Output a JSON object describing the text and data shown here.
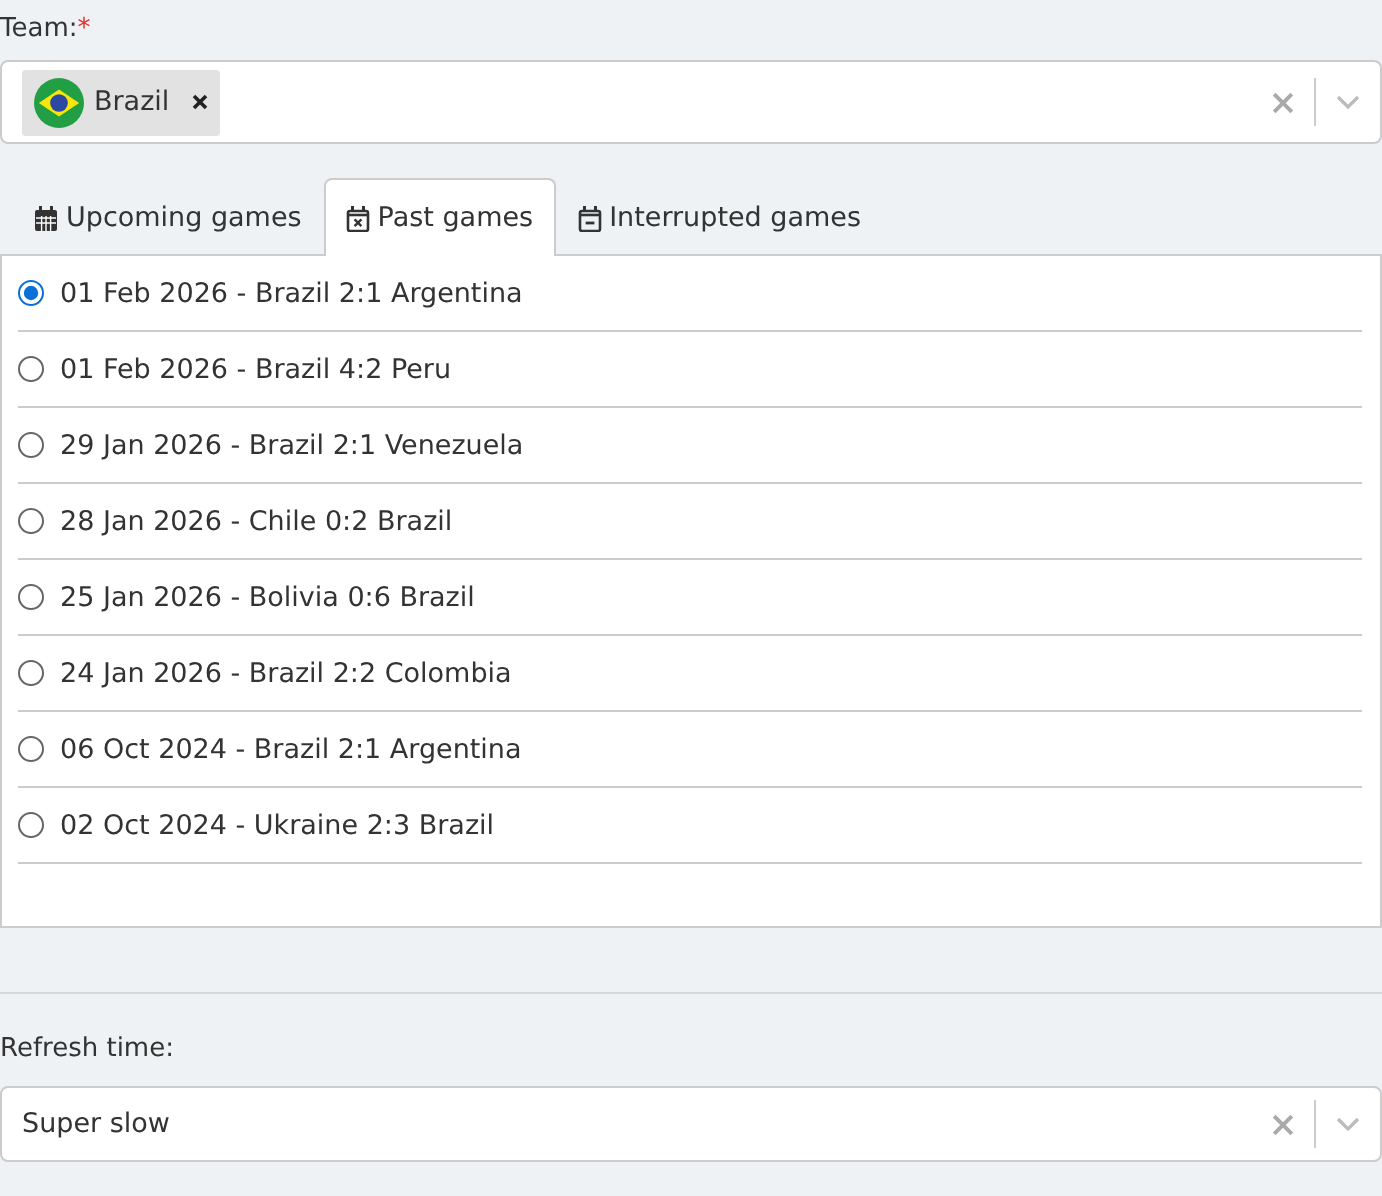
{
  "team": {
    "label": "Team:",
    "required_mark": "*",
    "chips": [
      {
        "label": "Brazil"
      }
    ]
  },
  "tabs": [
    {
      "label": "Upcoming games",
      "kind": "calendar",
      "selected": false
    },
    {
      "label": "Past games",
      "kind": "calendar-x",
      "selected": true
    },
    {
      "label": "Interrupted games",
      "kind": "calendar-minus",
      "selected": false
    }
  ],
  "games": [
    {
      "label": "01 Feb 2026 - Brazil 2:1 Argentina",
      "selected": true
    },
    {
      "label": "01 Feb 2026 - Brazil 4:2 Peru",
      "selected": false
    },
    {
      "label": "29 Jan 2026 - Brazil 2:1 Venezuela",
      "selected": false
    },
    {
      "label": "28 Jan 2026 - Chile 0:2 Brazil",
      "selected": false
    },
    {
      "label": "25 Jan 2026 - Bolivia 0:6 Brazil",
      "selected": false
    },
    {
      "label": "24 Jan 2026 - Brazil 2:2 Colombia",
      "selected": false
    },
    {
      "label": "06 Oct 2024 - Brazil 2:1 Argentina",
      "selected": false
    },
    {
      "label": "02 Oct 2024 - Ukraine 2:3 Brazil",
      "selected": false
    }
  ],
  "refresh": {
    "label": "Refresh time:",
    "value": "Super slow"
  }
}
